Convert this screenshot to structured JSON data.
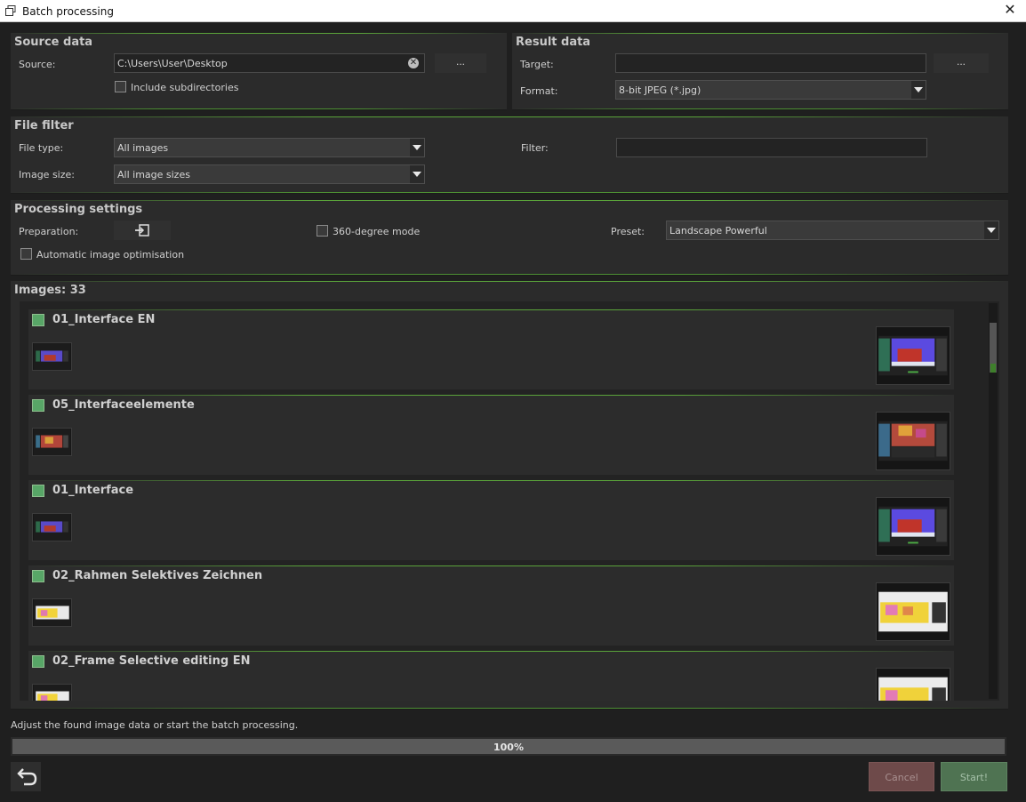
{
  "window": {
    "title": "Batch processing",
    "close_glyph": "✕",
    "icon": "batch-icon"
  },
  "source": {
    "heading": "Source data",
    "source_label": "Source:",
    "source_value": "C:\\Users\\User\\Desktop",
    "clear_glyph": "✕",
    "browse_label": "...",
    "include_subdirs_label": "Include subdirectories"
  },
  "result": {
    "heading": "Result data",
    "target_label": "Target:",
    "target_value": "",
    "browse_label": "...",
    "format_label": "Format:",
    "format_value": "8-bit JPEG (*.jpg)"
  },
  "filter": {
    "heading": "File filter",
    "file_type_label": "File type:",
    "file_type_value": "All images",
    "image_size_label": "Image size:",
    "image_size_value": "All image sizes",
    "filter_label": "Filter:",
    "filter_value": ""
  },
  "processing": {
    "heading": "Processing settings",
    "preparation_label": "Preparation:",
    "mode360_label": "360-degree mode",
    "preset_label": "Preset:",
    "preset_value": "Landscape Powerful",
    "auto_opt_label": "Automatic image optimisation"
  },
  "images": {
    "heading": "Images: 33",
    "items": [
      {
        "name": "01_Interface EN",
        "thumb": "interface"
      },
      {
        "name": "05_Interfaceelemente",
        "thumb": "flowers"
      },
      {
        "name": "01_Interface",
        "thumb": "interface"
      },
      {
        "name": "02_Rahmen Selektives Zeichnen",
        "thumb": "yellow"
      },
      {
        "name": "02_Frame Selective editing EN",
        "thumb": "yellow"
      }
    ]
  },
  "footer": {
    "status_text": "Adjust the found image data or start the batch processing.",
    "progress_text": "100%",
    "progress_value": 1.0,
    "cancel_label": "Cancel",
    "start_label": "Start!"
  }
}
